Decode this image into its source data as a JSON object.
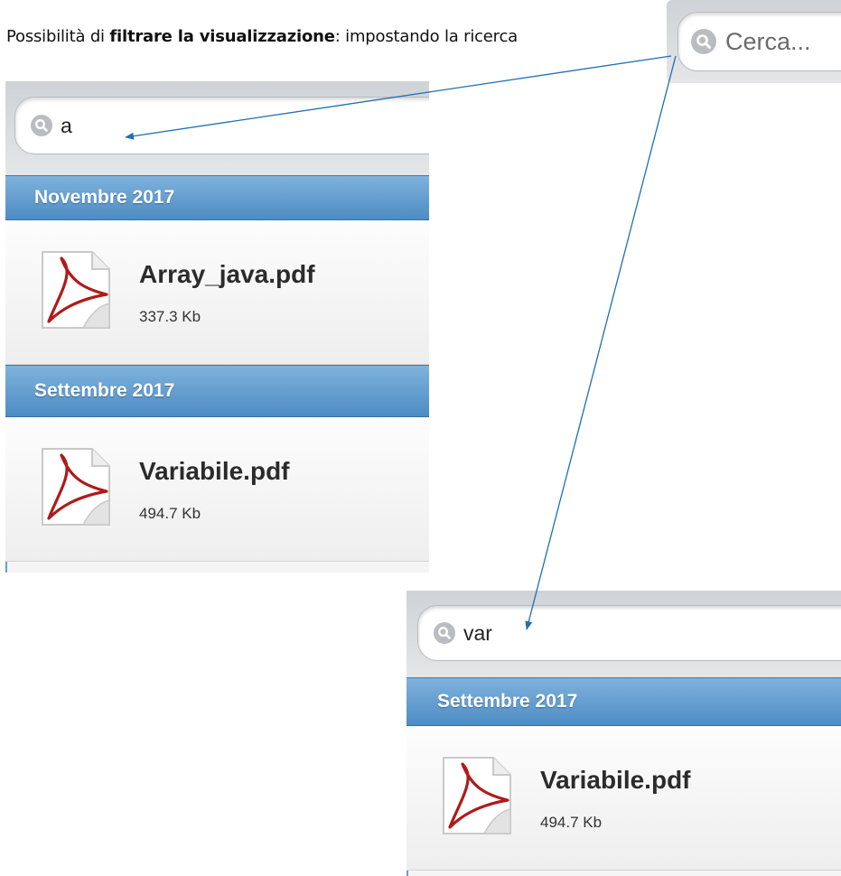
{
  "caption": {
    "prefix": "Possibilità di ",
    "bold": "filtrare la visualizzazione",
    "suffix": ": impostando la ricerca"
  },
  "search_empty": {
    "placeholder": "Cerca..."
  },
  "example1": {
    "query": "a",
    "groups": [
      {
        "header": "Novembre 2017",
        "files": [
          {
            "name": "Array_java.pdf",
            "size": "337.3 Kb"
          }
        ]
      },
      {
        "header": "Settembre 2017",
        "files": [
          {
            "name": "Variabile.pdf",
            "size": "494.7 Kb"
          }
        ]
      }
    ]
  },
  "example2": {
    "query": "var",
    "groups": [
      {
        "header": "Settembre 2017",
        "files": [
          {
            "name": "Variabile.pdf",
            "size": "494.7 Kb"
          }
        ]
      }
    ]
  },
  "icons": {
    "search": "magnifier-icon",
    "file": "pdf-icon"
  },
  "colors": {
    "header_blue": "#5a97cc",
    "arrow_blue": "#1f6fb5",
    "pdf_red": "#b01a1a"
  }
}
